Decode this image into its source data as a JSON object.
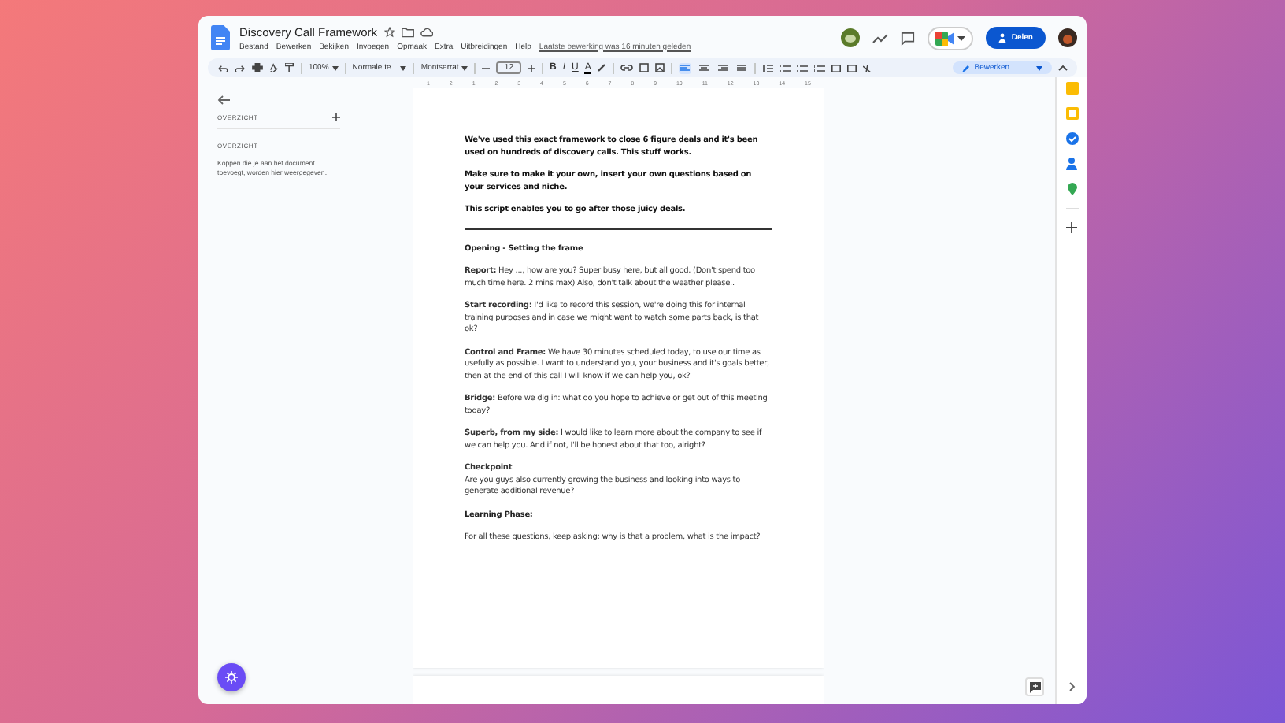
{
  "document": {
    "title": "Discovery Call Framework",
    "last_edit": "Laatste bewerking was 16 minuten geleden"
  },
  "menu": [
    "Bestand",
    "Bewerken",
    "Bekijken",
    "Invoegen",
    "Opmaak",
    "Extra",
    "Uitbreidingen",
    "Help"
  ],
  "share_button": "Delen",
  "toolbar": {
    "zoom": "100%",
    "style": "Normale te...",
    "font": "Montserrat",
    "font_size": "12",
    "mode": "Bewerken",
    "format": [
      "B",
      "I",
      "U",
      "A"
    ]
  },
  "ruler": [
    "1",
    "2",
    "1",
    "2",
    "3",
    "4",
    "5",
    "6",
    "7",
    "8",
    "9",
    "10",
    "11",
    "12",
    "13",
    "14",
    "15"
  ],
  "outline": {
    "header": "OVERZICHT",
    "section": "OVERZICHT",
    "hint": "Koppen die je aan het document toevoegt, worden hier weergegeven."
  },
  "paragraphs": [
    {
      "kind": "lead",
      "text": "We've used this exact framework to close 6 figure deals and it's been used on hundreds of discovery calls. This stuff works."
    },
    {
      "kind": "lead",
      "text": "Make sure to make it your own, insert your own questions based on your services and niche."
    },
    {
      "kind": "lead",
      "text": "This script enables you to go after those juicy deals."
    },
    {
      "kind": "rule"
    },
    {
      "kind": "heading",
      "text": "Opening - Setting the frame"
    },
    {
      "kind": "para",
      "text": "**Report:** Hey ..., how are you? Super busy here, but all good. (Don't spend too much time here. 2 mins max) Also, don't talk about the weather please.."
    },
    {
      "kind": "para",
      "text": "**Start recording:** I'd like to record this session, we're doing this for internal training purposes and in case we might want to watch some parts back, is that ok?"
    },
    {
      "kind": "para",
      "text": "**Control and Frame:** We have 30 minutes scheduled today, to use our time as usefully as possible. I want to understand you, your business and it's goals better, then at the end of this call I will know if we can help you, ok?"
    },
    {
      "kind": "para",
      "text": "**Bridge:** Before we dig in: what do you hope to achieve or get out of this meeting today?"
    },
    {
      "kind": "para",
      "text": "**Superb, from my side:** I would like to learn more about the company to see if we can help you. And if not, I'll be honest about that too, alright?"
    },
    {
      "kind": "para",
      "text": "**Checkpoint**\nAre you guys also currently growing the business and looking into ways to generate additional revenue?"
    },
    {
      "kind": "heading",
      "text": "Learning Phase:"
    },
    {
      "kind": "para",
      "text": "For all these questions, keep asking: why is that a problem, what is the impact?"
    }
  ]
}
